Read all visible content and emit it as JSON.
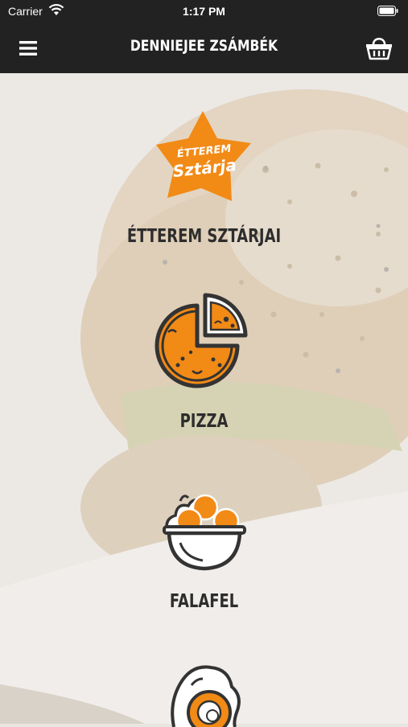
{
  "status_bar": {
    "carrier": "Carrier",
    "time": "1:17 PM"
  },
  "nav": {
    "title": "DENNIEJEE ZSÁMBÉK",
    "menu_icon": "hamburger-menu-icon",
    "basket_icon": "shopping-basket-icon"
  },
  "categories": [
    {
      "label": "ÉTTEREM SZTÁRJAI",
      "badge_line1": "ÉTTEREM",
      "badge_line2": "Sztárja",
      "icon": "star-badge-icon"
    },
    {
      "label": "PIZZA",
      "icon": "pizza-icon"
    },
    {
      "label": "FALAFEL",
      "icon": "falafel-bowl-icon"
    },
    {
      "label": "",
      "icon": "fried-egg-icon"
    }
  ],
  "colors": {
    "accent": "#f28a16",
    "dark": "#2d2d2d",
    "bar": "#222222"
  }
}
